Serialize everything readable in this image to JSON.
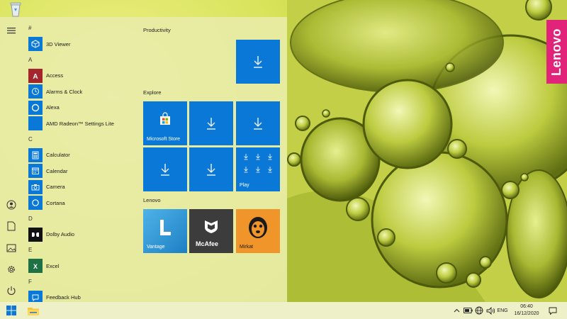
{
  "start_menu": {
    "apps": [
      {
        "letter": "#"
      },
      {
        "label": "3D Viewer",
        "icon": "cube-icon",
        "color": "#0a78d7"
      },
      {
        "letter": "A"
      },
      {
        "label": "Access",
        "icon": "access-icon",
        "color": "#a4262c"
      },
      {
        "label": "Alarms & Clock",
        "icon": "clock-icon",
        "color": "#0a78d7"
      },
      {
        "label": "Alexa",
        "icon": "alexa-icon",
        "color": "#0a78d7"
      },
      {
        "label": "AMD Radeon™ Settings Lite",
        "icon": "radeon-icon",
        "color": "#0a78d7"
      },
      {
        "letter": "C"
      },
      {
        "label": "Calculator",
        "icon": "calculator-icon",
        "color": "#0a78d7"
      },
      {
        "label": "Calendar",
        "icon": "calendar-icon",
        "color": "#0a78d7"
      },
      {
        "label": "Camera",
        "icon": "camera-icon",
        "color": "#0a78d7"
      },
      {
        "label": "Cortana",
        "icon": "cortana-icon",
        "color": "#0a78d7"
      },
      {
        "letter": "D"
      },
      {
        "label": "Dolby Audio",
        "icon": "dolby-icon",
        "color": "#111111"
      },
      {
        "letter": "E"
      },
      {
        "label": "Excel",
        "icon": "excel-icon",
        "color": "#1e7145"
      },
      {
        "letter": "F"
      },
      {
        "label": "Feedback Hub",
        "icon": "feedback-icon",
        "color": "#0a78d7"
      }
    ],
    "groups": {
      "productivity": "Productivity",
      "explore": "Explore",
      "lenovo": "Lenovo"
    },
    "tiles": {
      "ms_store": "Microsoft Store",
      "play": "Play",
      "vantage": "Vantage",
      "mcafee": "McAfee",
      "mirkat": "Mirkat"
    }
  },
  "wallpaper": {
    "brand": "Lenovo"
  },
  "taskbar": {
    "lang": "ENG",
    "time": "06:40",
    "date": "16/12/2020"
  },
  "colors": {
    "tile_blue": "#0a78d7",
    "lenovo_pink": "#e2237a",
    "mcafee_bg": "#3c3c3c",
    "mirkat_bg": "#f0952a"
  }
}
